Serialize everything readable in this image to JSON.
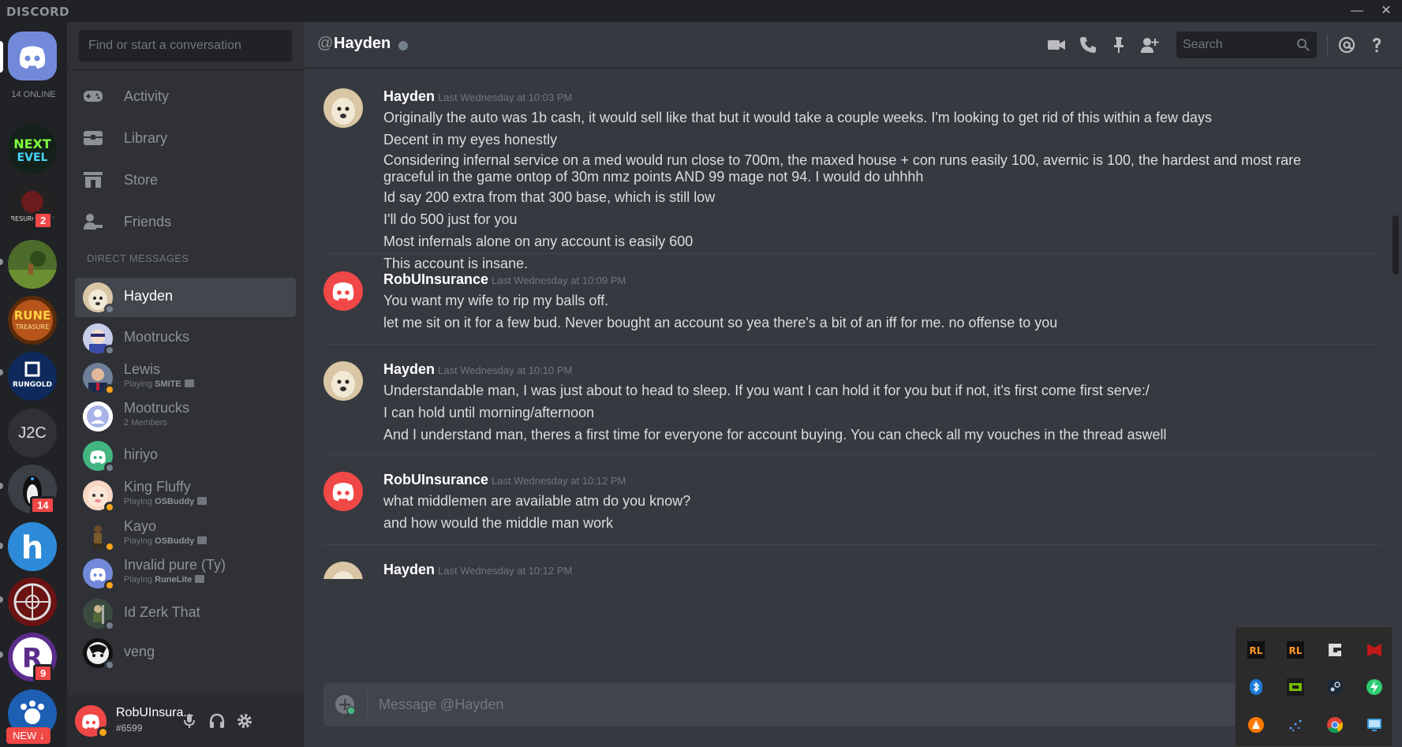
{
  "app": {
    "brand": "DISCORD"
  },
  "window_controls": {
    "minimize": "—",
    "maximize": "☐",
    "close": "✕"
  },
  "servers": {
    "online_count": "14 ONLINE",
    "items": [
      {
        "name": "Next Level",
        "icon": "next-level-server-icon",
        "badge": ""
      },
      {
        "name": "Resurgence",
        "icon": "resurgence-server-icon",
        "badge": "2"
      },
      {
        "name": "RS Landscape",
        "icon": "landscape-server-icon",
        "badge": ""
      },
      {
        "name": "Rune Treasure",
        "icon": "rune-treasure-server-icon",
        "badge": ""
      },
      {
        "name": "RunGold",
        "icon": "rungold-server-icon",
        "badge": ""
      },
      {
        "name": "J2C",
        "icon": "j2c-server-icon",
        "badge": ""
      },
      {
        "name": "Penguin",
        "icon": "penguin-server-icon",
        "badge": "14"
      },
      {
        "name": "h",
        "icon": "h-server-icon",
        "badge": ""
      },
      {
        "name": "Wheel",
        "icon": "wheel-server-icon",
        "badge": ""
      },
      {
        "name": "R",
        "icon": "r-server-icon",
        "badge": "9"
      },
      {
        "name": "Paw",
        "icon": "paw-server-icon",
        "badge": ""
      }
    ],
    "j2c_label": "J2C",
    "badge_2": "2",
    "badge_14": "14",
    "badge_9": "9",
    "new_label": "NEW ↓"
  },
  "sidebar": {
    "search_placeholder": "Find or start a conversation",
    "nav": [
      {
        "label": "Activity",
        "icon": "gamepad-icon"
      },
      {
        "label": "Library",
        "icon": "library-icon"
      },
      {
        "label": "Store",
        "icon": "store-icon"
      },
      {
        "label": "Friends",
        "icon": "friends-icon"
      }
    ],
    "dm_header": "DIRECT MESSAGES",
    "dms": [
      {
        "name": "Hayden",
        "sub": "",
        "sub_game": "",
        "active": true
      },
      {
        "name": "Mootrucks",
        "sub": "",
        "sub_game": ""
      },
      {
        "name": "Lewis",
        "sub": "Playing ",
        "sub_game": "SMITE"
      },
      {
        "name": "Mootrucks",
        "sub": "2 Members",
        "sub_game": ""
      },
      {
        "name": "hiriyo",
        "sub": "",
        "sub_game": ""
      },
      {
        "name": "King Fluffy",
        "sub": "Playing ",
        "sub_game": "OSBuddy"
      },
      {
        "name": "Kayo",
        "sub": "Playing ",
        "sub_game": "OSBuddy"
      },
      {
        "name": "Invalid pure (Ty)",
        "sub": "Playing ",
        "sub_game": "RuneLite"
      },
      {
        "name": "Id Zerk That",
        "sub": "",
        "sub_game": ""
      },
      {
        "name": "veng",
        "sub": "",
        "sub_game": ""
      }
    ]
  },
  "user_panel": {
    "username": "RobUInsura...",
    "tag": "#6599"
  },
  "chat": {
    "at_symbol": "@",
    "title": "Hayden",
    "search_placeholder": "Search",
    "composer_placeholder": "Message @Hayden",
    "messages": [
      {
        "author": "Hayden",
        "timestamp": "Last Wednesday at 10:03 PM",
        "lines": [
          "Originally the auto was 1b cash, it would sell like that but it would take a couple weeks. I'm looking to get rid of this within a few days",
          "Decent in my eyes honestly",
          "Considering infernal service on a med would run close to 700m, the maxed house + con runs easily 100, avernic is 100, the hardest and most rare graceful in the game ontop of 30m nmz points AND 99 mage not 94. I would do uhhhh",
          "Id say 200 extra from that 300 base, which is still low",
          "I'll do 500 just for you",
          "Most infernals alone on any account is easily 600",
          "This account is insane."
        ]
      },
      {
        "author": "RobUInsurance",
        "timestamp": "Last Wednesday at 10:09 PM",
        "lines": [
          "You want my wife to rip my balls off.",
          "let me sit on it for a few bud. Never bought an account so yea there's a bit of an iff for me. no offense to you"
        ]
      },
      {
        "author": "Hayden",
        "timestamp": "Last Wednesday at 10:10 PM",
        "lines": [
          "Understandable man, I was just about to head to sleep. If you want I can hold it for you but if not, it's first come first serve:/",
          "I can hold until morning/afternoon",
          "And I understand man, theres a first time for everyone for account buying. You can check all my vouches in the thread aswell"
        ]
      },
      {
        "author": "RobUInsurance",
        "timestamp": "Last Wednesday at 10:12 PM",
        "lines": [
          "what middlemen are available atm do you know?",
          "and how would the middle man work"
        ]
      },
      {
        "author": "Hayden",
        "timestamp": "Last Wednesday at 10:12 PM",
        "lines": []
      }
    ]
  },
  "tray": {
    "icons": [
      "razer-icon",
      "razer-icon",
      "logitech-g-icon",
      "mcafee-icon",
      "bluetooth-icon",
      "nvidia-icon",
      "steam-icon",
      "battery-icon",
      "avast-icon",
      "network-icon",
      "chrome-icon",
      "display-icon"
    ]
  },
  "colors": {
    "blurple": "#7289da",
    "red": "#f04747",
    "idle": "#faa61a",
    "offline": "#747f8d",
    "green": "#43b581"
  }
}
